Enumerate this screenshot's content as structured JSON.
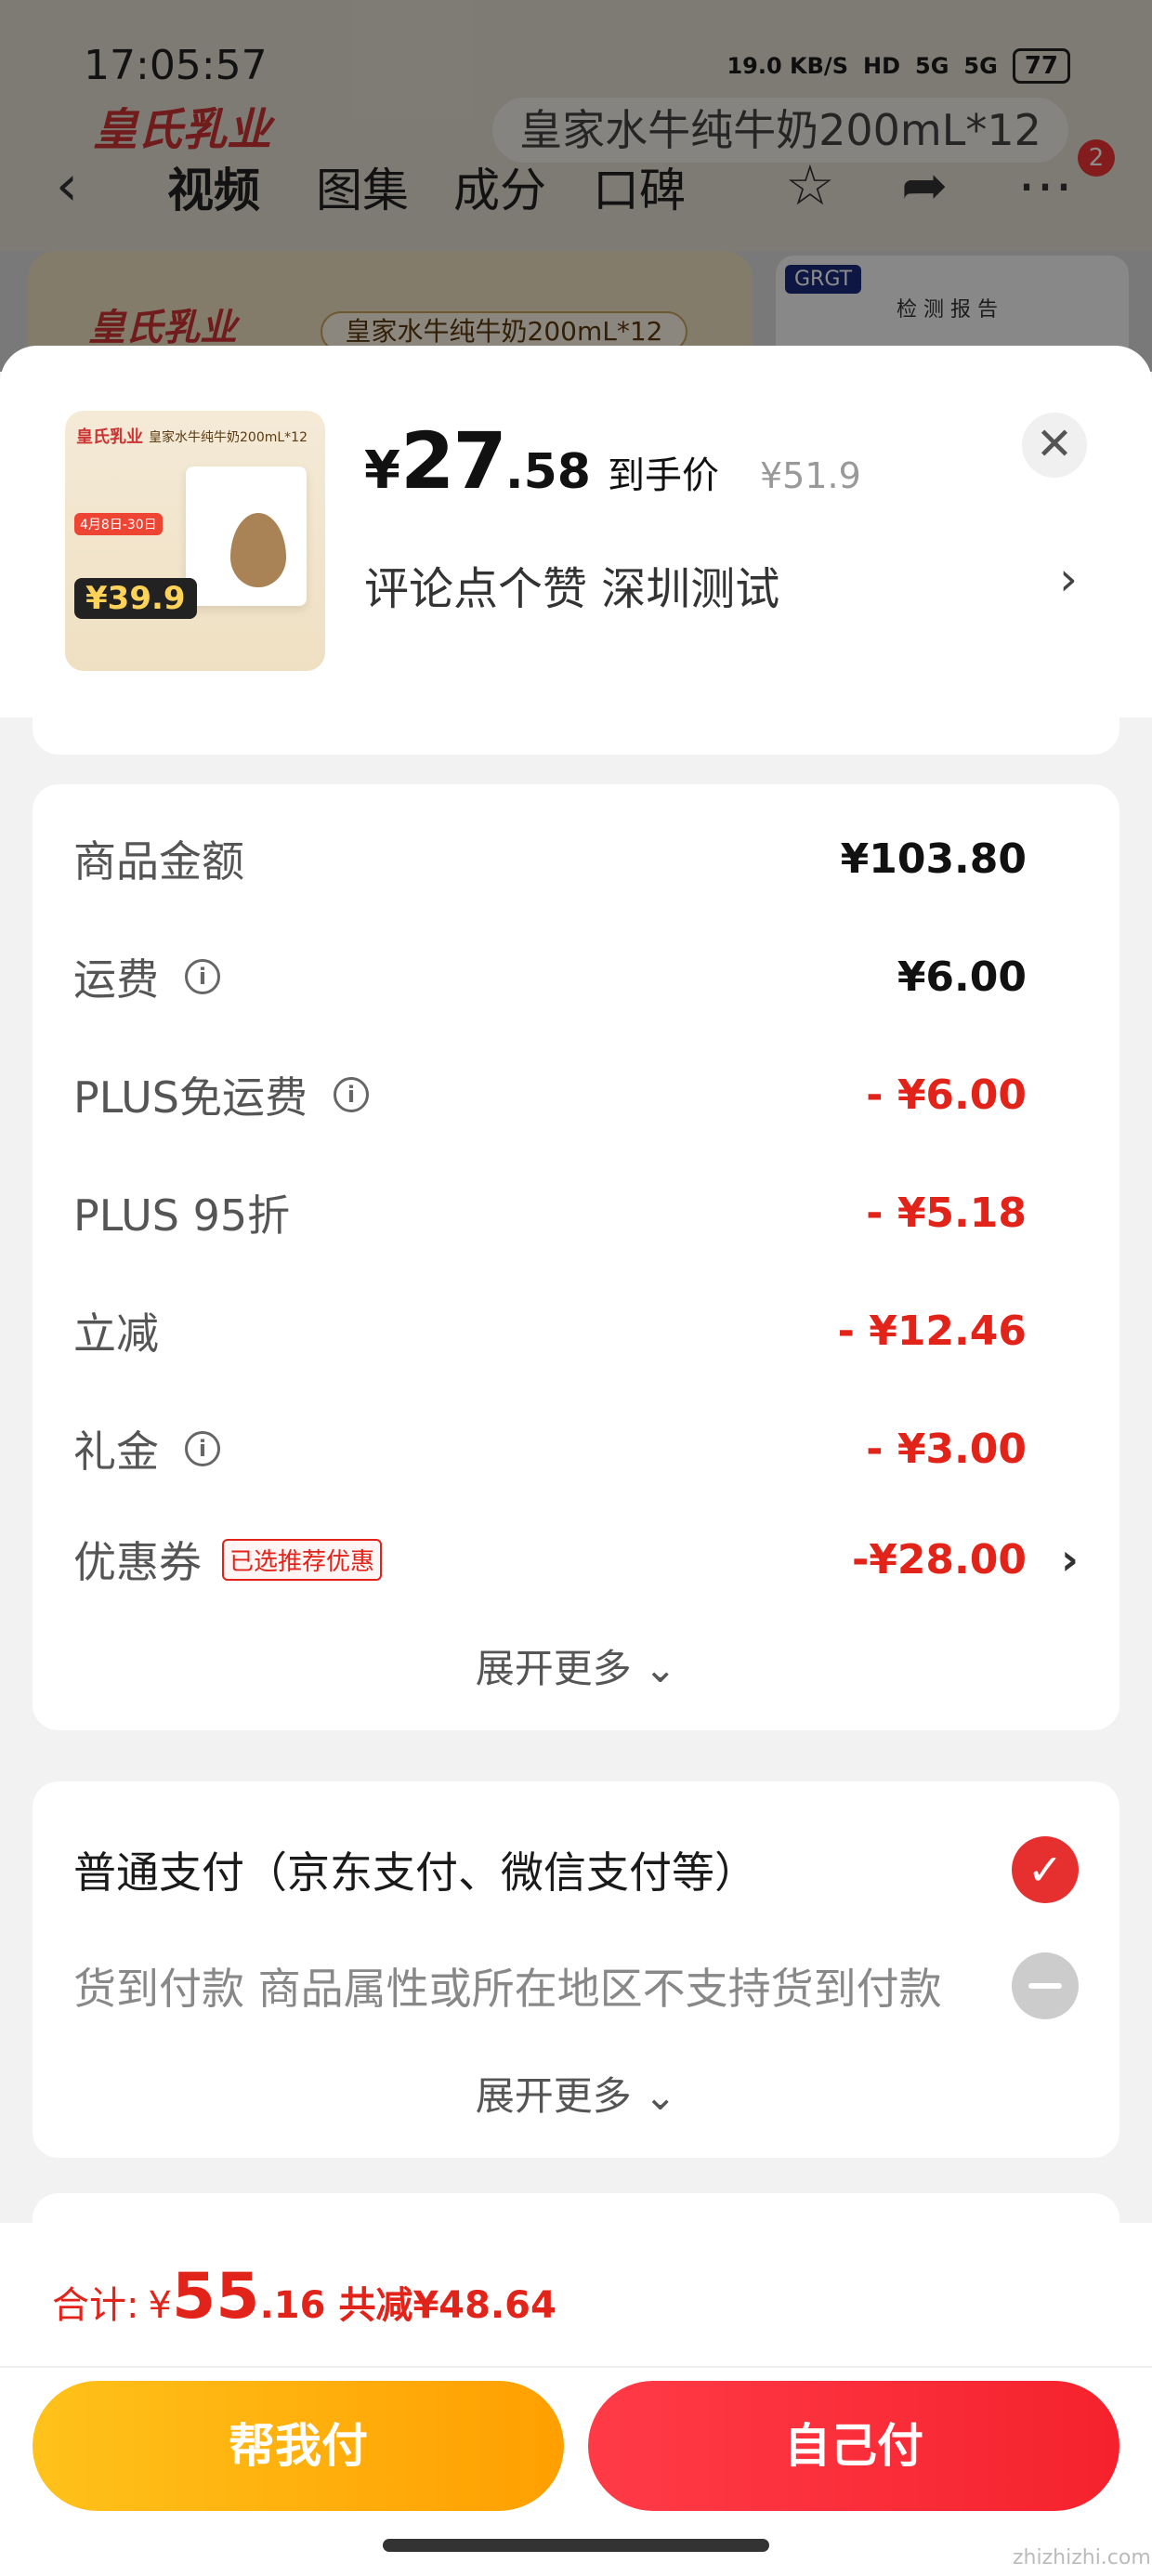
{
  "status_bar": {
    "time": "17:05:57",
    "net_speed": "19.0 KB/S",
    "hd": "HD",
    "signal1": "5G",
    "signal2": "5G",
    "battery": "77"
  },
  "background": {
    "nav_tabs": [
      "视频",
      "图集",
      "成分",
      "口碑"
    ],
    "product_title": "皇家水牛纯牛奶200mL*12",
    "brand": "皇氏乳业",
    "banner_pill": "皇家水牛纯牛奶200mL*12",
    "report_tag": "GRGT",
    "report_title": "检 测 报 告",
    "more_badge": "2"
  },
  "product": {
    "thumb_brand": "皇氏乳业",
    "thumb_title": "皇家水牛纯牛奶200mL*12",
    "thumb_date": "4月8日-30日",
    "thumb_price": "¥39.9",
    "price_symbol": "¥",
    "price_int": "27",
    "price_dec": ".58",
    "price_label": "到手价",
    "orig_price": "¥51.9",
    "spec": "评论点个赞  深圳测试",
    "close": "✕",
    "spec_chevron": "›"
  },
  "summary": {
    "rows": [
      {
        "label": "商品金额",
        "value": "¥103.80"
      },
      {
        "label": "运费",
        "value": "¥6.00"
      },
      {
        "label": "PLUS免运费",
        "value": "- ¥6.00"
      },
      {
        "label": "PLUS 95折",
        "value": "- ¥5.18"
      },
      {
        "label": "立减",
        "value": "- ¥12.46"
      },
      {
        "label": "礼金",
        "value": "- ¥3.00"
      },
      {
        "label": "优惠券",
        "value": "-¥28.00",
        "tag": "已选推荐优惠"
      }
    ],
    "expand_more": "展开更多 ⌄",
    "info_icon": "i",
    "chevron": "›"
  },
  "payment": {
    "options": [
      {
        "label": "普通支付（京东支付、微信支付等）"
      },
      {
        "label": "货到付款 商品属性或所在地区不支持货到付款"
      }
    ],
    "expand_more": "展开更多 ⌄",
    "check": "✓"
  },
  "bottom_bar": {
    "total_label": "合计:",
    "total_symbol": "¥",
    "total_int": "55",
    "total_dec": ".16",
    "total_reduce": "共减¥48.64",
    "help_pay": "帮我付",
    "self_pay": "自己付",
    "watermark": "zhizhizhi.com"
  },
  "colors": {
    "accent_red": "#e2231a",
    "help_button": "#ffb000",
    "self_button": "#f5222d"
  }
}
